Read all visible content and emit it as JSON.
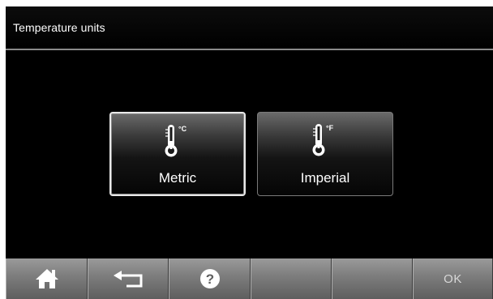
{
  "header": {
    "title": "Temperature units"
  },
  "options": [
    {
      "id": "metric",
      "label": "Metric",
      "unit": "°C",
      "icon": "thermometer-celsius-icon",
      "selected": true
    },
    {
      "id": "imperial",
      "label": "Imperial",
      "unit": "°F",
      "icon": "thermometer-fahrenheit-icon",
      "selected": false
    }
  ],
  "bottom_bar": {
    "home_icon": "home-icon",
    "back_icon": "back-arrow-icon",
    "help_icon": "help-icon",
    "ok_label": "OK"
  },
  "colors": {
    "background": "#000000",
    "selected_border": "#e8e8e8",
    "bottom_bar": "#7c7c7c"
  }
}
